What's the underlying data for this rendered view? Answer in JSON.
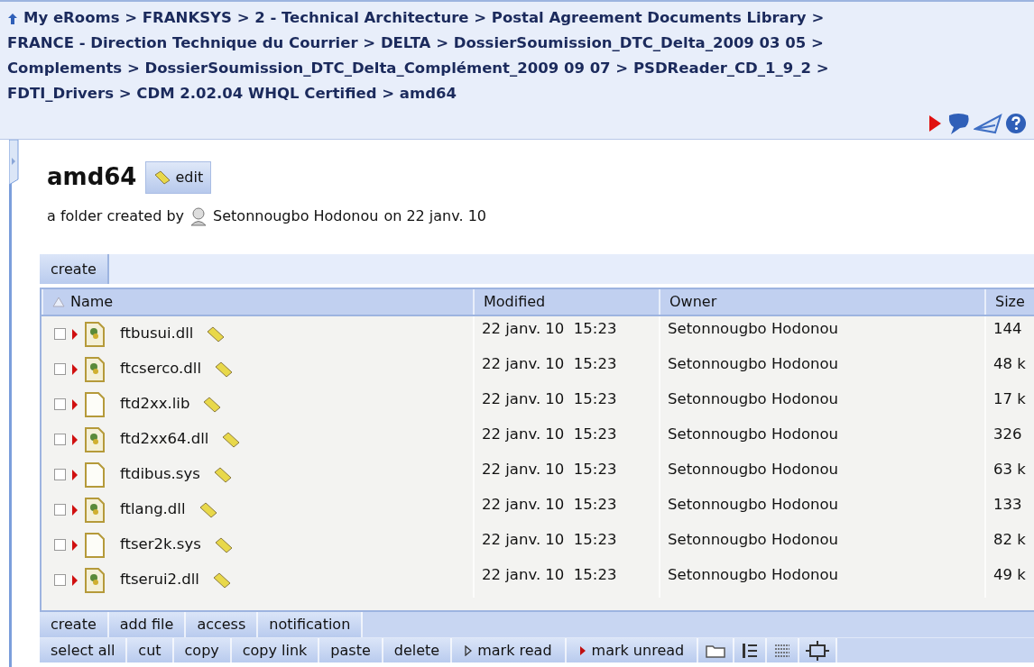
{
  "breadcrumb": [
    {
      "label": "My eRooms",
      "separator": ">"
    },
    {
      "label": "FRANKSYS",
      "separator": ">"
    },
    {
      "label": "2 - Technical Architecture",
      "separator": ">"
    },
    {
      "label": "Postal Agreement Documents Library",
      "separator": ">"
    },
    {
      "label": "FRANCE - Direction Technique du Courrier",
      "separator": ">"
    },
    {
      "label": "DELTA",
      "separator": ">"
    },
    {
      "label": "DossierSoumission_DTC_Delta_2009 03 05",
      "separator": ">"
    },
    {
      "label": "Complements",
      "separator": ">"
    },
    {
      "label": "DossierSoumission_DTC_Delta_Complément_2009 09 07",
      "separator": ">"
    },
    {
      "label": "PSDReader_CD_1_9_2",
      "separator": ">"
    },
    {
      "label": "FDTI_Drivers",
      "separator": ">"
    },
    {
      "label": "CDM 2.02.04 WHQL Certified",
      "separator": ">"
    },
    {
      "label": "amd64"
    }
  ],
  "title": "amd64",
  "edit_button": "edit",
  "subtitle": {
    "before": "a folder created by",
    "owner": "Setonnougbo Hodonou",
    "after": "on 22 janv. 10"
  },
  "top_toolbar": [
    "create"
  ],
  "table": {
    "columns": [
      "Name",
      "Modified",
      "Owner",
      "Size"
    ],
    "rows": [
      {
        "kind": "app",
        "checked": false,
        "name": "ftbusui.dll",
        "modified": "22 janv. 10  15:23",
        "owner": "Setonnougbo Hodonou",
        "size": "144"
      },
      {
        "kind": "app",
        "checked": false,
        "name": "ftcserco.dll",
        "modified": "22 janv. 10  15:23",
        "owner": "Setonnougbo Hodonou",
        "size": "48 k"
      },
      {
        "kind": "blank",
        "checked": false,
        "name": "ftd2xx.lib",
        "modified": "22 janv. 10  15:23",
        "owner": "Setonnougbo Hodonou",
        "size": "17 k"
      },
      {
        "kind": "app",
        "checked": false,
        "name": "ftd2xx64.dll",
        "modified": "22 janv. 10  15:23",
        "owner": "Setonnougbo Hodonou",
        "size": "326"
      },
      {
        "kind": "blank",
        "checked": false,
        "name": "ftdibus.sys",
        "modified": "22 janv. 10  15:23",
        "owner": "Setonnougbo Hodonou",
        "size": "63 k"
      },
      {
        "kind": "app",
        "checked": false,
        "name": "ftlang.dll",
        "modified": "22 janv. 10  15:23",
        "owner": "Setonnougbo Hodonou",
        "size": "133"
      },
      {
        "kind": "blank",
        "checked": false,
        "name": "ftser2k.sys",
        "modified": "22 janv. 10  15:23",
        "owner": "Setonnougbo Hodonou",
        "size": "82 k"
      },
      {
        "kind": "app",
        "checked": false,
        "name": "ftserui2.dll",
        "modified": "22 janv. 10  15:23",
        "owner": "Setonnougbo Hodonou",
        "size": "49 k"
      }
    ]
  },
  "bottom_toolbar": [
    "create",
    "add file",
    "access",
    "notification"
  ],
  "action_toolbar": [
    {
      "kind": "text",
      "label": "select all"
    },
    {
      "kind": "text",
      "label": "cut"
    },
    {
      "kind": "text",
      "label": "copy"
    },
    {
      "kind": "text",
      "label": "copy link"
    },
    {
      "kind": "text",
      "label": "paste"
    },
    {
      "kind": "text",
      "label": "delete"
    },
    {
      "kind": "read",
      "label": "mark read"
    },
    {
      "kind": "unread",
      "label": "mark unread"
    },
    {
      "kind": "folder"
    },
    {
      "kind": "list"
    },
    {
      "kind": "details"
    },
    {
      "kind": "frame"
    }
  ]
}
